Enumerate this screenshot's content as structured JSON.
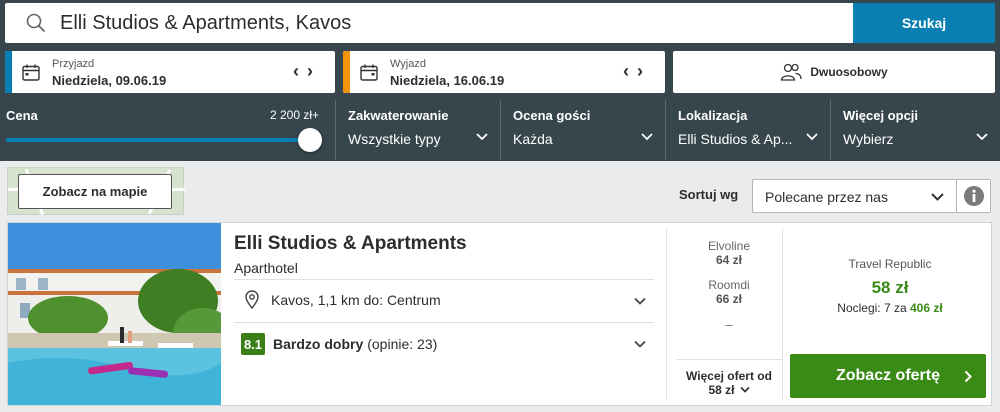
{
  "search": {
    "query": "Elli Studios & Apartments, Kavos",
    "button_label": "Szukaj"
  },
  "checkin": {
    "label": "Przyjazd",
    "value": "Niedziela, 09.06.19"
  },
  "checkout": {
    "label": "Wyjazd",
    "value": "Niedziela, 16.06.19"
  },
  "room": {
    "label": "Dwuosobowy"
  },
  "filters": {
    "price": {
      "title": "Cena",
      "max": "2 200 zł+",
      "level": 1.0
    },
    "accommodation": {
      "title": "Zakwaterowanie",
      "value": "Wszystkie typy"
    },
    "rating": {
      "title": "Ocena gości",
      "value": "Każda"
    },
    "location": {
      "title": "Lokalizacja",
      "value": "Elli Studios & Ap..."
    },
    "more": {
      "title": "Więcej opcji",
      "value": "Wybierz"
    }
  },
  "map_button": "Zobacz na mapie",
  "sort": {
    "label": "Sortuj wg",
    "value": "Polecane przez nas"
  },
  "hotel": {
    "name": "Elli Studios & Apartments",
    "type": "Aparthotel",
    "location": "Kavos, 1,1 km do: Centrum",
    "rating_score": "8.1",
    "rating_text": "Bardzo dobry",
    "rating_count": "(opinie: 23)"
  },
  "alt_offers": [
    {
      "provider": "Elvoline",
      "price": "64 zł"
    },
    {
      "provider": "Roomdi",
      "price": "66 zł"
    }
  ],
  "alt_dash": "–",
  "more_offers": {
    "line1": "Więcej ofert od",
    "price": "58 zł"
  },
  "best_offer": {
    "provider": "Travel Republic",
    "price": "58 zł",
    "nights_prefix": "Noclegi: 7 za",
    "nights_total": "406 zł",
    "cta": "Zobacz ofertę"
  },
  "colors": {
    "accent_blue": "#0a7fb1",
    "accent_orange": "#f29407",
    "green": "#3a8a16",
    "dark_bg": "#37454d"
  }
}
